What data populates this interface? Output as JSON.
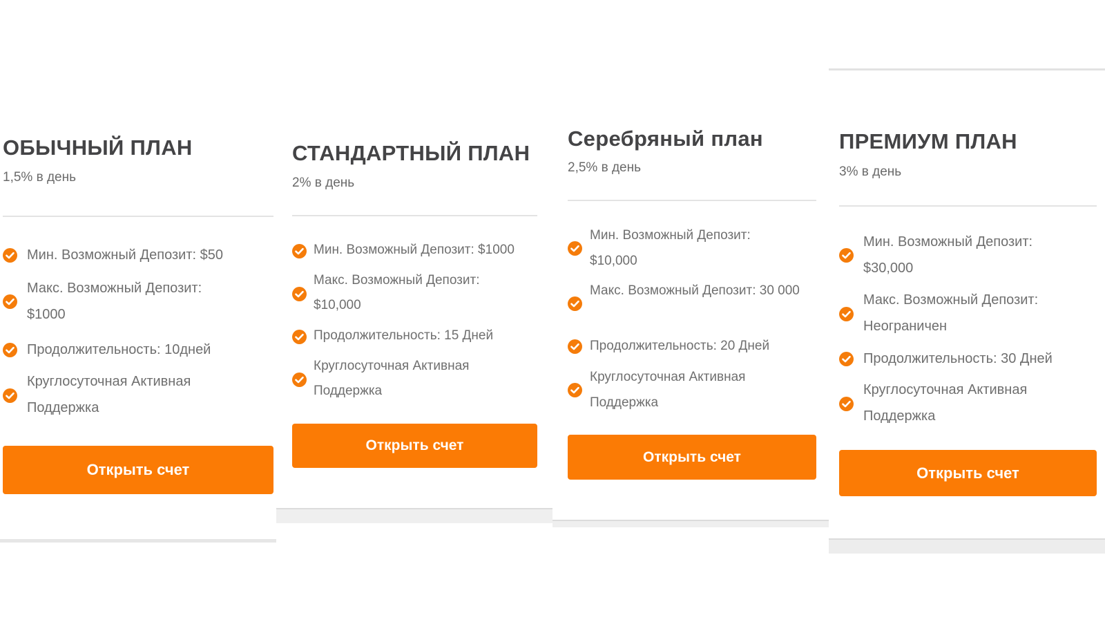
{
  "plans": [
    {
      "title": "ОБЫЧНЫЙ ПЛАН",
      "rate": "1,5% в день",
      "features": [
        "Мин. Возможный Депозит: $50",
        "Макс. Возможный Депозит: $1000",
        "Продолжительность: 10дней",
        "Круглосуточная Активная Поддержка"
      ],
      "button": "Открыть счет"
    },
    {
      "title": "СТАНДАРТНЫЙ ПЛАН",
      "rate": "2% в день",
      "features": [
        "Мин. Возможный Депозит: $1000",
        "Макс. Возможный Депозит: $10,000",
        "Продолжительность: 15 Дней",
        "Круглосуточная Активная Поддержка"
      ],
      "button": "Открыть счет"
    },
    {
      "title": "Серебряный план",
      "rate": "2,5% в день",
      "features": [
        "Мин. Возможный Депозит: $10,000",
        "Макс. Возможный Депозит: 30 000",
        "Продолжительность: 20 Дней",
        "Круглосуточная Активная Поддержка"
      ],
      "button": "Открыть счет"
    },
    {
      "title": "ПРЕМИУМ ПЛАН",
      "rate": "3% в день",
      "features": [
        "Мин. Возможный Депозит: $30,000",
        "Макс. Возможный Депозит: Неограничен",
        "Продолжительность: 30 Дней",
        "Круглосуточная Активная Поддержка"
      ],
      "button": "Открыть счет"
    }
  ],
  "icons": {
    "feature_bullet": "check-circle-icon"
  },
  "colors": {
    "accent": "#fb7b05",
    "check": "#f57c0a",
    "title": "#444446",
    "text": "#6f6f6f"
  }
}
